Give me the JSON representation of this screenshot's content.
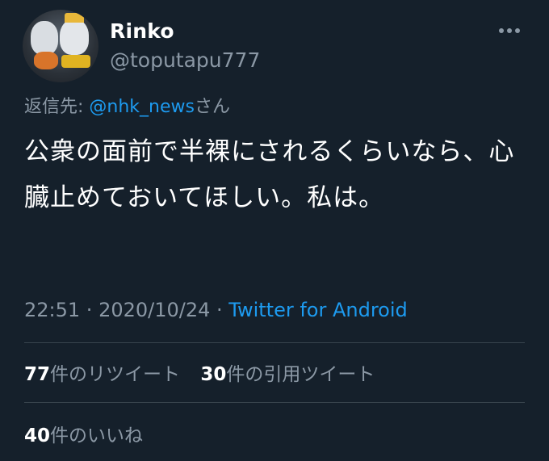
{
  "user": {
    "display_name": "Rinko",
    "handle": "@toputapu777"
  },
  "reply": {
    "prefix": "返信先: ",
    "mention": "@nhk_news",
    "suffix": "さん"
  },
  "tweet": {
    "text": "公衆の面前で半裸にされるくらいなら、心臓止めておいてほしい。私は。"
  },
  "meta": {
    "time": "22:51",
    "sep1": " · ",
    "date": "2020/10/24",
    "sep2": " · ",
    "source": "Twitter for Android"
  },
  "stats": {
    "retweets_count": "77",
    "retweets_label": "件のリツイート",
    "quotes_count": "30",
    "quotes_label": "件の引用ツイート",
    "likes_count": "40",
    "likes_label": "件のいいね"
  },
  "icons": {
    "more": "more-options-icon",
    "avatar": "avatar-image"
  },
  "colors": {
    "background": "#15202b",
    "accent": "#1d9bf0",
    "secondary_text": "#8b98a5"
  }
}
